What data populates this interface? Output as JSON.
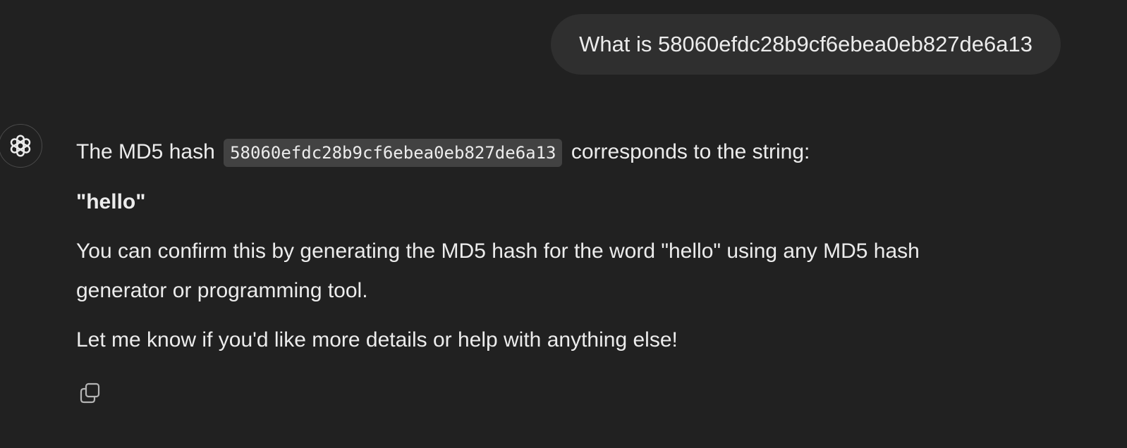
{
  "user_message": {
    "text": "What is 58060efdc28b9cf6ebea0eb827de6a13"
  },
  "assistant": {
    "avatar_icon": "openai-logo-icon",
    "p1_before": "The MD5 hash",
    "p1_code": "58060efdc28b9cf6ebea0eb827de6a13",
    "p1_after": "corresponds to the string:",
    "answer": "\"hello\"",
    "p3": "You can confirm this by generating the MD5 hash for the word \"hello\" using any MD5 hash generator or programming tool.",
    "p4": "Let me know if you'd like more details or help with anything else!"
  },
  "actions": {
    "copy_icon": "copy-icon"
  },
  "colors": {
    "background": "#212121",
    "user_bubble": "#2f2f2f",
    "inline_code": "#424242",
    "text": "#ececec"
  }
}
